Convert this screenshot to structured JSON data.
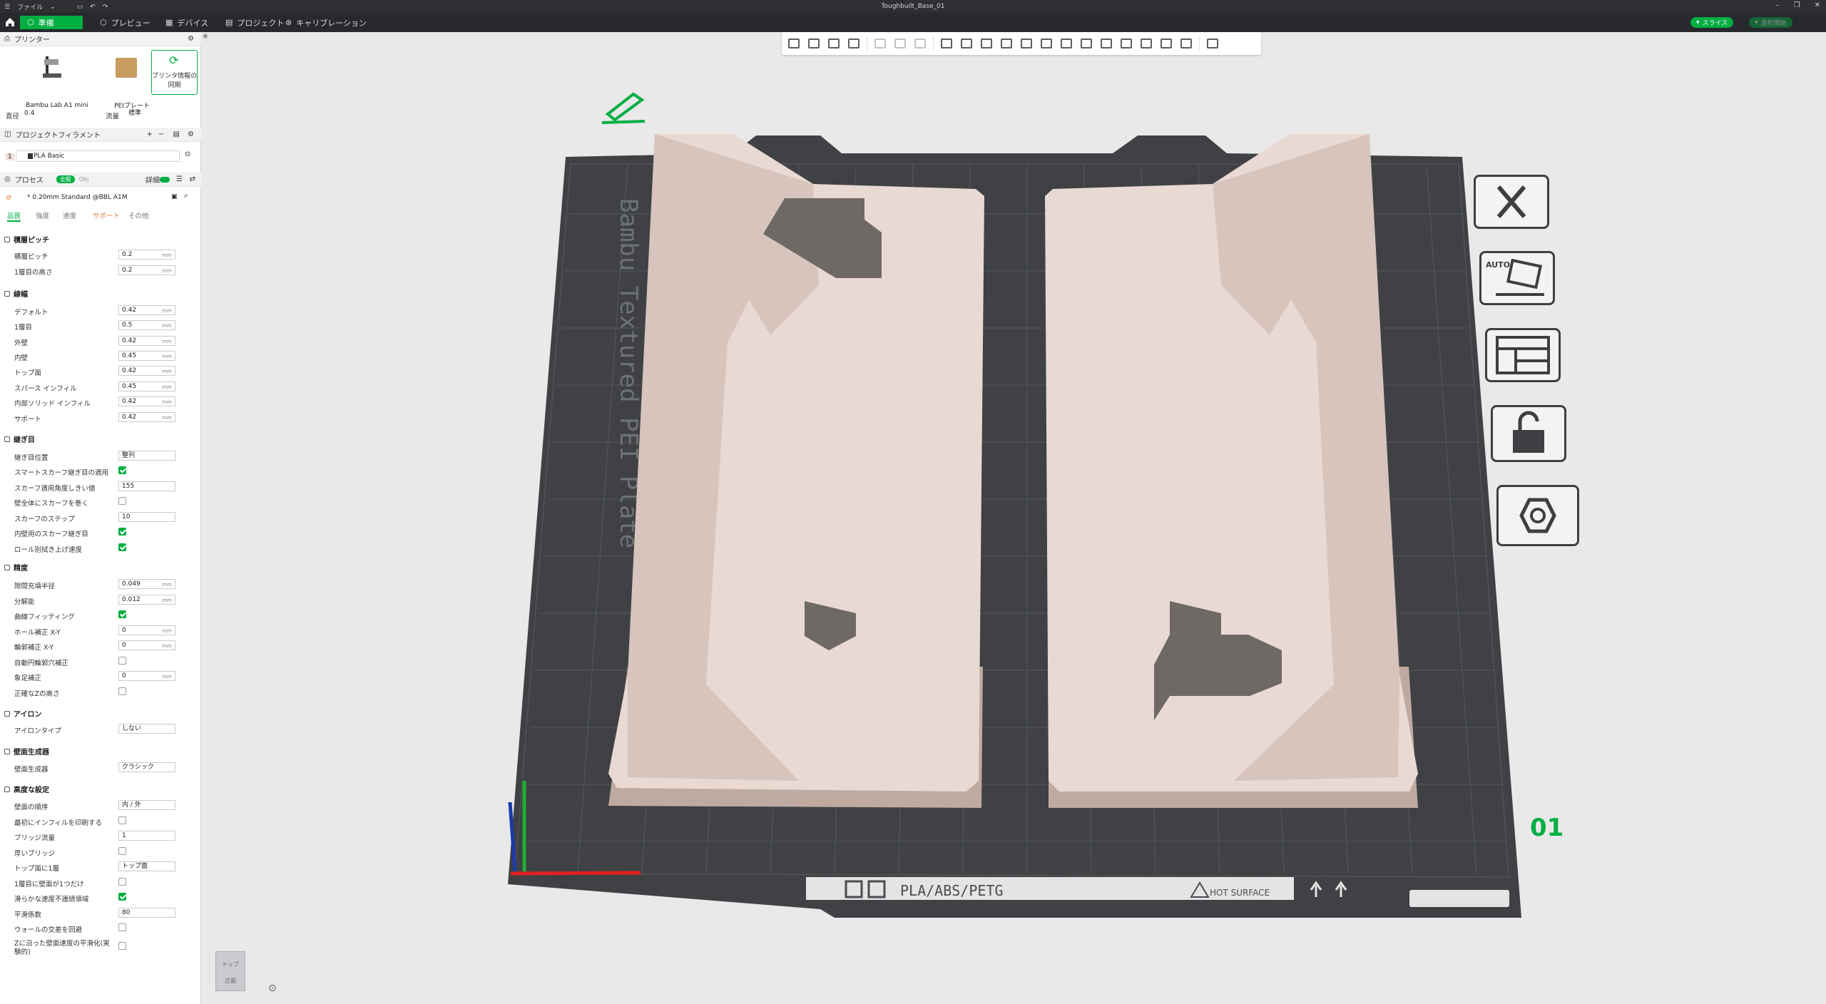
{
  "window": {
    "title": "Toughbuilt_Base_01",
    "menu_label": "ファイル"
  },
  "nav": {
    "tabs": [
      {
        "label": "準備",
        "icon": "prepare-icon",
        "active": true
      },
      {
        "label": "プレビュー",
        "icon": "preview-icon",
        "active": false
      },
      {
        "label": "デバイス",
        "icon": "device-icon",
        "active": false
      },
      {
        "label": "プロジェクト",
        "icon": "project-icon",
        "active": false
      },
      {
        "label": "キャリブレーション",
        "icon": "calibration-icon",
        "active": false
      }
    ],
    "slice_label": "スライス",
    "send_label": "造形開始",
    "accent": "#00ae42"
  },
  "printer": {
    "section_label": "プリンター",
    "name": "Bambu Lab A1 mini",
    "plate": "PEIプレート",
    "sync_label": "プリンタ情報の同期",
    "nozzle_label": "直径",
    "nozzle_value": "0.4",
    "flow_label": "流量",
    "flow_value": "標準"
  },
  "filament": {
    "section_label": "プロジェクトフィラメント",
    "index": "1",
    "name": "PLA Basic"
  },
  "process": {
    "section_label": "プロセス",
    "toggle_global": "全般",
    "toggle_obj": "Obj",
    "detail_label": "詳細",
    "preset": "* 0.20mm Standard @BBL A1M",
    "tabs": [
      "品質",
      "強度",
      "速度",
      "サポート",
      "その他"
    ]
  },
  "params": {
    "layer_group": "積層ピッチ",
    "layer_height_label": "積層ピッチ",
    "layer_height": "0.2",
    "first_layer_label": "1層目の高さ",
    "first_layer": "0.2",
    "width_group": "線幅",
    "w_default_label": "デフォルト",
    "w_default": "0.42",
    "w_first_label": "1層目",
    "w_first": "0.5",
    "w_outer_label": "外壁",
    "w_outer": "0.42",
    "w_inner_label": "内壁",
    "w_inner": "0.45",
    "w_top_label": "トップ面",
    "w_top": "0.42",
    "w_sparse_label": "スパース インフィル",
    "w_sparse": "0.45",
    "w_solid_label": "内部ソリッド インフィル",
    "w_solid": "0.42",
    "w_support_label": "サポート",
    "w_support": "0.42",
    "seam_group": "継ぎ目",
    "seam_pos_label": "継ぎ目位置",
    "seam_pos": "整列",
    "smart_scarf_label": "スマートスカーフ継ぎ目の適用",
    "scarf_angle_label": "スカーフ適用角度しきい値",
    "scarf_angle": "155",
    "scarf_entire_label": "壁全体にスカーフを巻く",
    "scarf_steps_label": "スカーフのステップ",
    "scarf_steps": "10",
    "inner_scarf_label": "内壁用のスカーフ継ぎ目",
    "role_wipe_label": "ロール別拭き上げ速度",
    "precision_group": "精度",
    "gap_label": "隙間充填半径",
    "gap": "0.049",
    "resolution_label": "分解能",
    "resolution": "0.012",
    "arc_label": "曲線フィッティング",
    "hole_xy_label": "ホール補正 X-Y",
    "hole_xy": "0",
    "contour_xy_label": "輪郭補正 X-Y",
    "contour_xy": "0",
    "auto_circle_label": "自動円輪郭穴補正",
    "elephant_label": "象足補正",
    "elephant": "0",
    "precise_z_label": "正確なZの高さ",
    "ironing_group": "アイロン",
    "ironing_type_label": "アイロンタイプ",
    "ironing_type": "しない",
    "wallgen_group": "壁面生成器",
    "wallgen_label": "壁面生成器",
    "wallgen": "クラシック",
    "advanced_group": "高度な設定",
    "wall_order_label": "壁面の順序",
    "wall_order": "内 / 外",
    "infill_first_label": "最初にインフィルを印刷する",
    "bridge_flow_label": "ブリッジ流量",
    "bridge_flow": "1",
    "thick_bridge_label": "厚いブリッジ",
    "top_one_wall_label": "トップ面に1層",
    "top_one_wall": "トップ面",
    "first_one_wall_label": "1層目に壁面が1つだけ",
    "smooth_speed_label": "滑らかな速度不連続領域",
    "smooth_coef_label": "平滑係数",
    "smooth_coef": "80",
    "avoid_cross_label": "ウォールの交差を回避",
    "z_smooth_label": "Zに沿った壁面速度の平滑化(実験的)"
  },
  "viewport": {
    "plate_label": "Bambu Textured PEI Plate",
    "material_label": "PLA/ABS/PETG",
    "hot_label": "HOT SURFACE",
    "plate_number": "01",
    "auto_label": "AUTO",
    "navcube_top": "トップ",
    "navcube_front": "正面"
  }
}
